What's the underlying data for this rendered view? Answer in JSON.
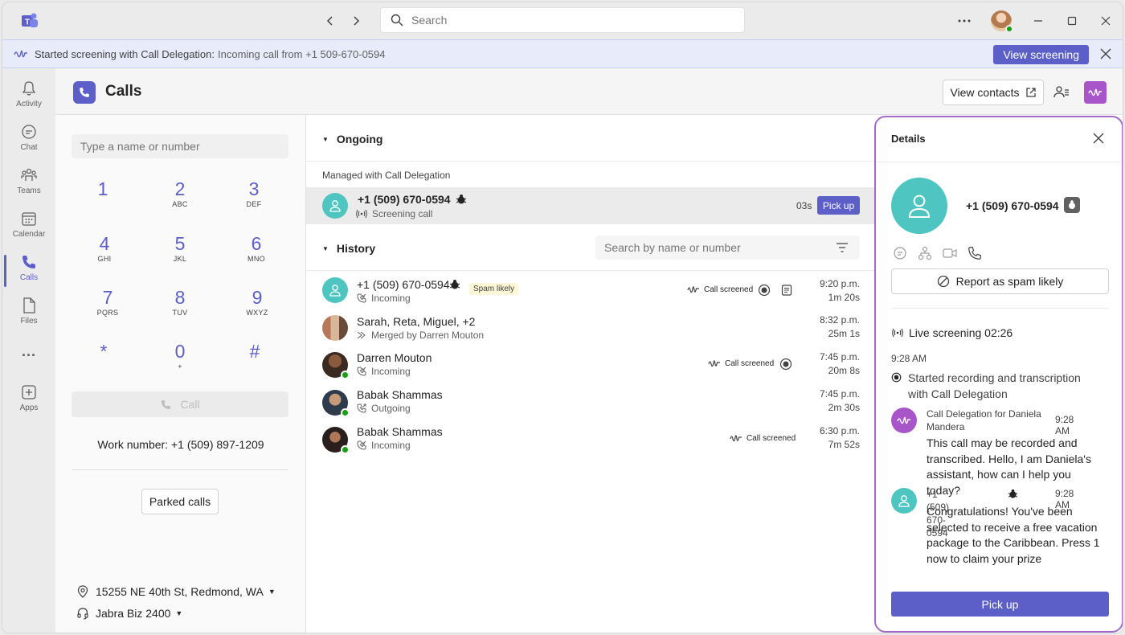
{
  "titlebar": {
    "search_placeholder": "Search"
  },
  "banner": {
    "label": "Started screening with Call Delegation:",
    "message": "Incoming call from +1 509-670-0594",
    "button": "View screening"
  },
  "rail": {
    "items": [
      {
        "label": "Activity"
      },
      {
        "label": "Chat"
      },
      {
        "label": "Teams"
      },
      {
        "label": "Calendar"
      },
      {
        "label": "Calls"
      },
      {
        "label": "Files"
      },
      {
        "label": "..."
      },
      {
        "label": "Apps"
      }
    ]
  },
  "header": {
    "title": "Calls",
    "view_contacts": "View contacts"
  },
  "dialpad": {
    "placeholder": "Type a name or number",
    "keys": [
      {
        "digit": "1",
        "letters": ""
      },
      {
        "digit": "2",
        "letters": "ABC"
      },
      {
        "digit": "3",
        "letters": "DEF"
      },
      {
        "digit": "4",
        "letters": "GHI"
      },
      {
        "digit": "5",
        "letters": "JKL"
      },
      {
        "digit": "6",
        "letters": "MNO"
      },
      {
        "digit": "7",
        "letters": "PQRS"
      },
      {
        "digit": "8",
        "letters": "TUV"
      },
      {
        "digit": "9",
        "letters": "WXYZ"
      },
      {
        "digit": "*",
        "letters": ""
      },
      {
        "digit": "0",
        "letters": "+"
      },
      {
        "digit": "#",
        "letters": ""
      }
    ],
    "call_label": "Call",
    "work_number": "Work number: +1 (509) 897-1209",
    "parked_calls": "Parked calls",
    "location": "15255 NE 40th St, Redmond, WA",
    "device": "Jabra Biz 2400"
  },
  "ongoing": {
    "title": "Ongoing",
    "managed_label": "Managed with Call Delegation",
    "call": {
      "number": "+1 (509) 670-0594",
      "status": "Screening call",
      "duration": "03s",
      "pickup": "Pick up"
    }
  },
  "history": {
    "title": "History",
    "search_placeholder": "Search by name or number",
    "rows": [
      {
        "name": "+1 (509) 670-0594",
        "sub": "Incoming",
        "tag": "Spam likely",
        "screened": "Call screened",
        "time": "9:20 p.m.",
        "duration": "1m 20s"
      },
      {
        "name": "Sarah, Reta, Miguel, +2",
        "sub": "Merged by Darren Mouton",
        "tag": "",
        "screened": "",
        "time": "8:32 p.m.",
        "duration": "25m 1s"
      },
      {
        "name": "Darren Mouton",
        "sub": "Incoming",
        "tag": "",
        "screened": "Call screened",
        "time": "7:45 p.m.",
        "duration": "20m 8s"
      },
      {
        "name": "Babak Shammas",
        "sub": "Outgoing",
        "tag": "",
        "screened": "",
        "time": "7:45 p.m.",
        "duration": "2m 30s"
      },
      {
        "name": "Babak Shammas",
        "sub": "Incoming",
        "tag": "",
        "screened": "Call screened",
        "time": "6:30 p.m.",
        "duration": "7m 52s"
      }
    ]
  },
  "details": {
    "title": "Details",
    "number": "+1 (509) 670-0594",
    "report_spam": "Report as spam likely",
    "live_screening": "Live screening 02:26",
    "event_time": "9:28 AM",
    "event_text": "Started recording and transcription with Call Delegation",
    "messages": [
      {
        "from": "Call Delegation for Daniela Mandera",
        "time": "9:28 AM",
        "body": "This call may be recorded and transcribed. Hello, I am Daniela's assistant, how can I help you today?"
      },
      {
        "from": "+1 (509) 670-0594",
        "time": "9:28 AM",
        "body": "Congratulations! You've been selected to receive a free vacation package to the Caribbean. Press 1 now to claim your prize"
      }
    ],
    "pickup": "Pick up"
  },
  "colors": {
    "brand": "#5b5fc7",
    "avatar_teal": "#4fc5c1",
    "details_frame": "#a36ac7",
    "presence_available": "#13a10e"
  }
}
